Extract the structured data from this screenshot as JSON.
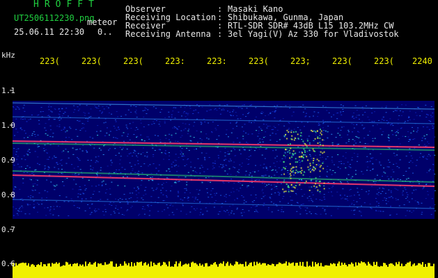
{
  "header": {
    "title": "HROFFT",
    "filename": "UT2506112230.png",
    "tag": "meteor",
    "datetime": "25.06.11 22:30",
    "zero": "0.."
  },
  "info": [
    {
      "label": "Observer",
      "value": "Masaki Kano"
    },
    {
      "label": "Receiving Location",
      "value": "Shibukawa, Gunma, Japan"
    },
    {
      "label": "Receiver",
      "value": "RTL-SDR SDR# 43dB L15 103.2MHz CW"
    },
    {
      "label": "Receiving Antenna",
      "value": "3el Yagi(V) Az 330 for Vladivostok"
    }
  ],
  "axis": {
    "y_unit": "kHz",
    "y_labels": [
      "1.1",
      "1.0",
      "0.9",
      "0.8",
      "0.7",
      "0.6"
    ],
    "x_labels": [
      "223(",
      "223(",
      "223(",
      "223:",
      "223:",
      "223(",
      "223;",
      "223(",
      "223(",
      "2240"
    ]
  },
  "colors": {
    "green": "#20d040",
    "white": "#e8e8e8",
    "yellow": "#f0f000",
    "spectrogram_background": "#00006a",
    "echo_red": "#ff3b6b"
  }
}
